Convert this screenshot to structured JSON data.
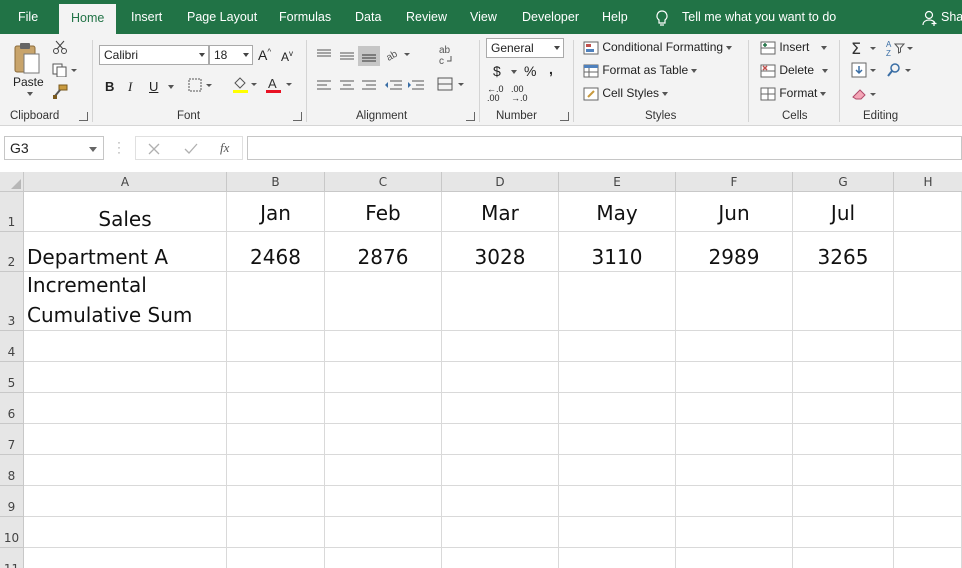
{
  "menubar": {
    "tabs": [
      "File",
      "Home",
      "Insert",
      "Page Layout",
      "Formulas",
      "Data",
      "Review",
      "View",
      "Developer",
      "Help"
    ],
    "active_tab": "Home",
    "tell_me": "Tell me what you want to do",
    "share": "Sha"
  },
  "ribbon": {
    "clipboard": {
      "paste_label": "Paste",
      "group_label": "Clipboard"
    },
    "font": {
      "font_name": "Calibri",
      "font_size": "18",
      "bold": "B",
      "italic": "I",
      "underline": "U",
      "group_label": "Font",
      "font_color": "#e81123"
    },
    "alignment": {
      "group_label": "Alignment"
    },
    "number": {
      "format": "General",
      "currency": "$",
      "percent": "%",
      "comma": ",",
      "inc_decimal": "←.0 .00",
      "dec_decimal": ".00 →.0",
      "group_label": "Number"
    },
    "styles": {
      "conditional": "Conditional Formatting",
      "format_table": "Format as Table",
      "cell_styles": "Cell Styles",
      "group_label": "Styles"
    },
    "cells": {
      "insert": "Insert",
      "delete": "Delete",
      "format": "Format",
      "group_label": "Cells"
    },
    "editing": {
      "group_label": "Editing"
    }
  },
  "formula_bar": {
    "name_box": "G3",
    "fx": "fx",
    "formula": ""
  },
  "sheet": {
    "columns": [
      "A",
      "B",
      "C",
      "D",
      "E",
      "F",
      "G",
      "H"
    ],
    "rows": [
      "1",
      "2",
      "3",
      "4",
      "5",
      "6",
      "7",
      "8",
      "9",
      "10",
      "11"
    ],
    "cells": {
      "A1": "Sales",
      "B1": "Jan",
      "C1": "Feb",
      "D1": "Mar",
      "E1": "May",
      "F1": "Jun",
      "G1": "Jul",
      "A2": "Department A",
      "B2": "2468",
      "C2": "2876",
      "D2": "3028",
      "E2": "3110",
      "F2": "2989",
      "G2": "3265",
      "A3_line1": "Incremental",
      "A3_line2": "Cumulative Sum"
    }
  },
  "colors": {
    "accent": "#217346",
    "ribbon_bg": "#f3f3f3",
    "header_bg": "#e6e6e6",
    "gridline": "#d9d9d9"
  }
}
